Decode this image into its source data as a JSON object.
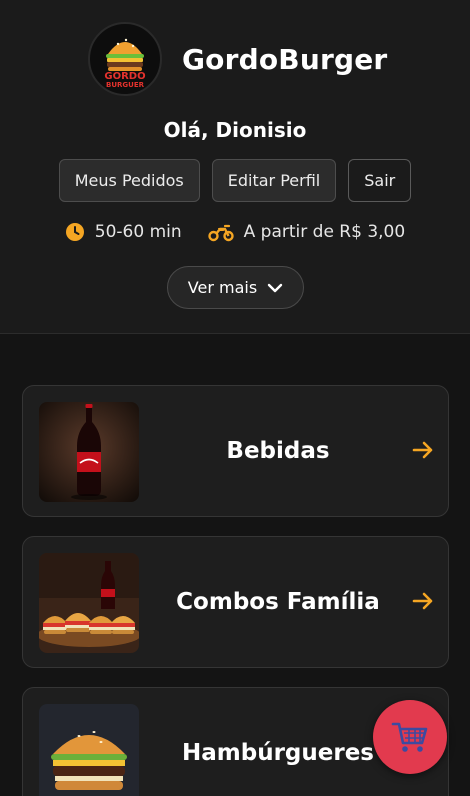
{
  "brand": {
    "name": "GordoBurger",
    "logo_line1": "GORDO",
    "logo_line2": "BURGUER"
  },
  "greeting": "Olá, Dionisio",
  "actions": {
    "orders": "Meus Pedidos",
    "edit_profile": "Editar Perfil",
    "logout": "Sair"
  },
  "info": {
    "delivery_time": "50-60 min",
    "delivery_fee": "A partir de R$ 3,00"
  },
  "more_button": "Ver mais",
  "categories": [
    {
      "label": "Bebidas",
      "icon": "soda-bottle-image"
    },
    {
      "label": "Combos Família",
      "icon": "family-combo-image"
    },
    {
      "label": "Hambúrgueres",
      "icon": "burger-image"
    }
  ],
  "colors": {
    "accent": "#f5a623",
    "cart": "#e23a4e",
    "background": "#141414",
    "card": "#1e1e1e"
  },
  "icons": {
    "clock": "clock-icon",
    "delivery": "motorcycle-icon",
    "more": "chevron-down-icon",
    "arrow": "arrow-right-icon",
    "cart": "shopping-cart-icon"
  }
}
